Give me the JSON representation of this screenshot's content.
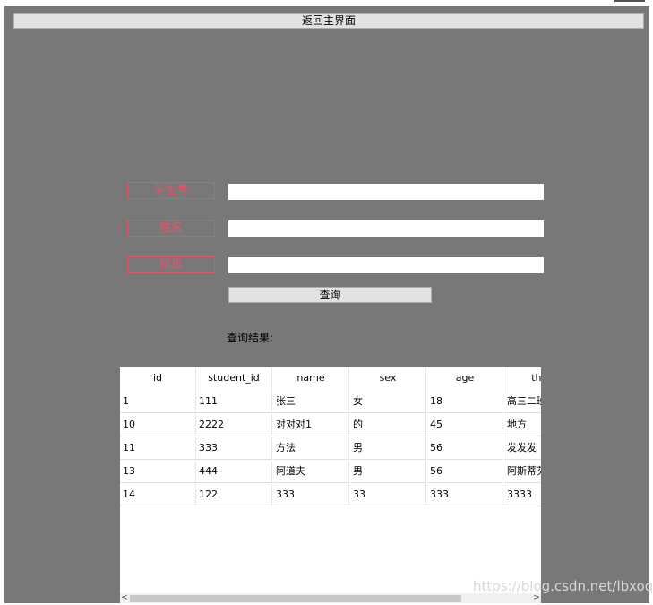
{
  "header": {
    "back_label": "返回主界面"
  },
  "form": {
    "student_no_label": "学生号",
    "name_label": "姓名",
    "class_label": "班级",
    "student_no_value": "",
    "name_value": "",
    "class_value": "",
    "query_label": "查询"
  },
  "results": {
    "label": "查询结果:",
    "columns": [
      "id",
      "student_id",
      "name",
      "sex",
      "age",
      "the_"
    ],
    "rows": [
      [
        "1",
        "111",
        "张三",
        "女",
        "18",
        "高三二班"
      ],
      [
        "10",
        "2222",
        "对对对1",
        "的",
        "45",
        "地方"
      ],
      [
        "11",
        "333",
        "方法",
        "男",
        "56",
        "发发发"
      ],
      [
        "13",
        "444",
        "阿道夫",
        "男",
        "56",
        "阿斯蒂芬"
      ],
      [
        "14",
        "122",
        "333",
        "33",
        "333",
        "3333"
      ]
    ],
    "scroll_left": "<",
    "scroll_right": ">"
  },
  "watermark": "https://blog.csdn.net/lbxoqy"
}
